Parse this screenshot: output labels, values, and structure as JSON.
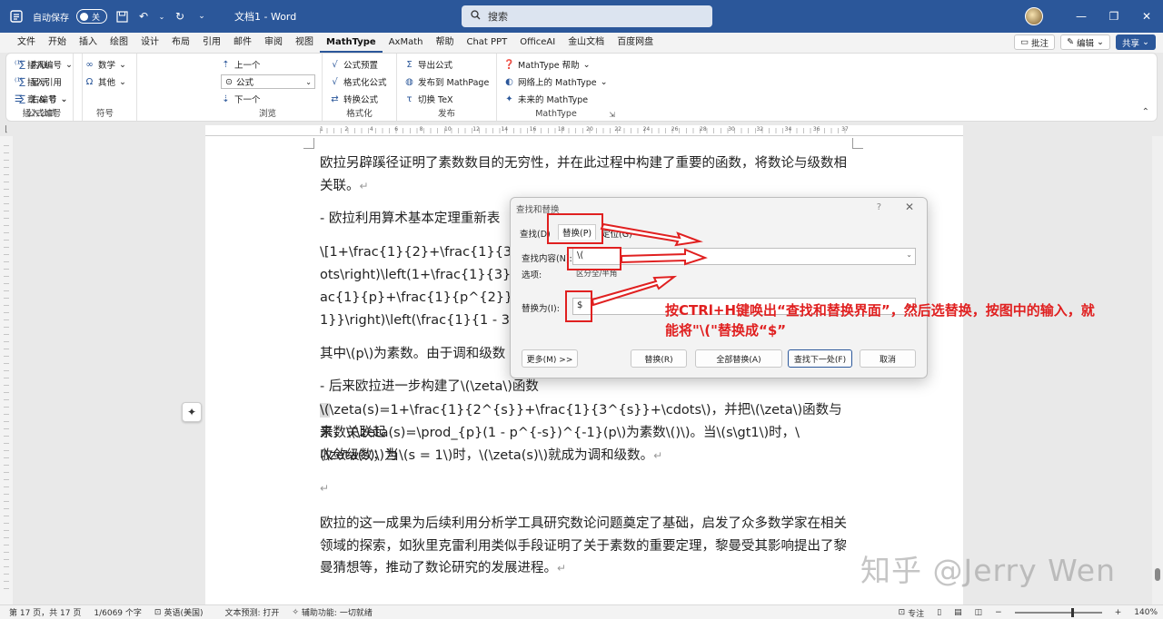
{
  "titlebar": {
    "autosave_label": "自动保存",
    "autosave_state": "关",
    "doc_title": "文档1 - Word",
    "search_placeholder": "搜索"
  },
  "tabs": [
    "文件",
    "开始",
    "插入",
    "绘图",
    "设计",
    "布局",
    "引用",
    "邮件",
    "审阅",
    "视图",
    "MathType",
    "AxMath",
    "帮助",
    "Chat PPT",
    "OfficeAI",
    "金山文档",
    "百度网盘"
  ],
  "active_tab": "MathType",
  "tabs_right": {
    "comment": "批注",
    "edit": "编辑",
    "share": "共享"
  },
  "ribbon": {
    "insert_group": {
      "label": "插入公式",
      "items": [
        "内联",
        "显示",
        "右编号"
      ]
    },
    "symbol_group": {
      "label": "符号",
      "items": [
        "数学",
        "其他"
      ]
    },
    "numbering_group": {
      "label": "公式编号",
      "items": [
        "插入编号",
        "插入引用",
        "章 & 节"
      ]
    },
    "browse_group": {
      "label": "浏览",
      "up": "上一个",
      "select_value": "公式",
      "down": "下一个"
    },
    "format_group": {
      "label": "格式化",
      "items": [
        "公式预置",
        "格式化公式",
        "转换公式"
      ]
    },
    "publish_group": {
      "label": "发布",
      "items": [
        "导出公式",
        "发布到 MathPage",
        "切换 TeX"
      ]
    },
    "mathtype_group": {
      "label": "MathType",
      "items": [
        "MathType 帮助",
        "网络上的 MathType",
        "未来的 MathType"
      ]
    }
  },
  "ruler_numbers": [
    "1",
    "2",
    "4",
    "6",
    "8",
    "10",
    "12",
    "14",
    "16",
    "18",
    "20",
    "22",
    "24",
    "26",
    "28",
    "30",
    "32",
    "34",
    "36",
    "37"
  ],
  "document": {
    "p1": "欧拉另辟蹊径证明了素数数目的无穷性，并在此过程中构建了重要的函数，将数论与级数相关联。",
    "p2": "-  欧拉利用算术基本定理重新表",
    "p3_l1": "\\[1+\\frac{1}{2}+\\frac{1}{3}+\\cdo",
    "p3_l2": "ots\\right)\\left(1+\\frac{1}{3}+\\fra",
    "p3_l3": "ac{1}{p}+\\frac{1}{p^{2}}+\\frac{1}",
    "p3_l4": "1}}\\right)\\left(\\frac{1}{1 - 3^{-1}",
    "p4": "其中\\(p\\)为素数。由于调和级数",
    "p5": "-  后来欧拉进一步构建了\\(\\zeta\\)函数",
    "p6_l1_hl": "\\(",
    "p6_l1": "\\zeta(s)=1+\\frac{1}{2^{s}}+\\frac{1}{3^{s}}+\\cdots\\)，并把\\(\\zeta\\)函数与素数关联起",
    "p6_l2": "来，\\(\\zeta(s)=\\prod_{p}(1 - p^{-s})^{-1}(p\\)为素数\\()\\)。当\\(s\\gt1\\)时，\\(\\zeta(s)\\)为",
    "p6_l3": "收敛级数；当\\(s = 1\\)时，\\(\\zeta(s)\\)就成为调和级数。",
    "p7": "欧拉的这一成果为后续利用分析学工具研究数论问题奠定了基础，启发了众多数学家在相关领域的探索，如狄里克雷利用类似手段证明了关于素数的重要定理，黎曼受其影响提出了黎曼猜想等，推动了数论研究的发展进程。",
    "para_mark": "↵"
  },
  "dialog": {
    "title": "查找和替换",
    "help": "?",
    "tabs": [
      "查找(D)",
      "替换(P)",
      "定位(G)"
    ],
    "find_label": "查找内容(N):",
    "find_value": "\\(",
    "options_label": "选项:",
    "options_value": "区分全/半角",
    "replace_label": "替换为(I):",
    "replace_value": "$",
    "buttons": {
      "more": "更多(M) >>",
      "replace": "替换(R)",
      "replace_all": "全部替换(A)",
      "find_next": "查找下一处(F)",
      "cancel": "取消"
    }
  },
  "annotation": {
    "text": "按CTRl+H键唤出“查找和替换界面”，然后选替换，按图中的输入，就能将\"\\(\"替换成“$”",
    "color": "#e02020"
  },
  "watermark": "知乎 @Jerry Wen",
  "statusbar": {
    "page": "第 17 页，共 17 页",
    "words": "1/6069 个字",
    "lang": "英语(美国)",
    "prediction": "文本预测: 打开",
    "accessibility": "辅助功能: 一切就绪",
    "focus": "专注",
    "zoom": "140%"
  },
  "colors": {
    "accent": "#2b579a",
    "annotation_red": "#e02020"
  }
}
